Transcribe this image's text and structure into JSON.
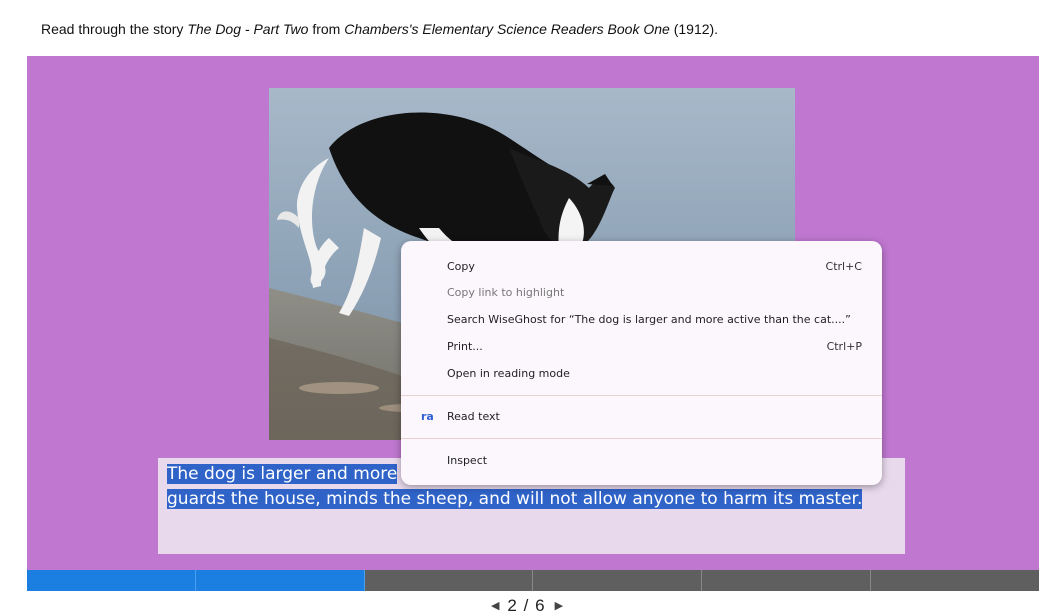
{
  "intro": {
    "prefix": "Read through the story ",
    "story_title": "The Dog - Part Two",
    "middle": " from ",
    "book_title": "Chambers's Elementary Science Readers Book One",
    "suffix": " (1912)."
  },
  "slide": {
    "image_icon": "dog-photo",
    "caption_line1": "The dog is larger and more ",
    "caption_line2": "guards the house, minds the sheep, and will not allow anyone to harm its master."
  },
  "progress": {
    "current": 2,
    "total": 6
  },
  "pager": {
    "current": "2",
    "separator": "/",
    "total": "6",
    "prev_icon": "triangle-left",
    "next_icon": "triangle-right"
  },
  "context_menu": {
    "items": [
      {
        "label": "Copy",
        "shortcut": "Ctrl+C"
      },
      {
        "label": "Copy link to highlight",
        "shortcut": ""
      },
      {
        "label": "Search WiseGhost for “The dog is larger and more active than the cat....”",
        "shortcut": ""
      },
      {
        "label": "Print...",
        "shortcut": "Ctrl+P"
      },
      {
        "label": "Open in reading mode",
        "shortcut": ""
      },
      {
        "label": "Read text",
        "shortcut": "",
        "icon_text": "ra"
      },
      {
        "label": "Inspect",
        "shortcut": ""
      }
    ]
  },
  "colors": {
    "stage": "#bf77d0",
    "caption_bg": "#e8d9ec",
    "selection": "#2f63c8",
    "progress_done": "#1a7fe0",
    "progress_todo": "#5f5f5f"
  }
}
